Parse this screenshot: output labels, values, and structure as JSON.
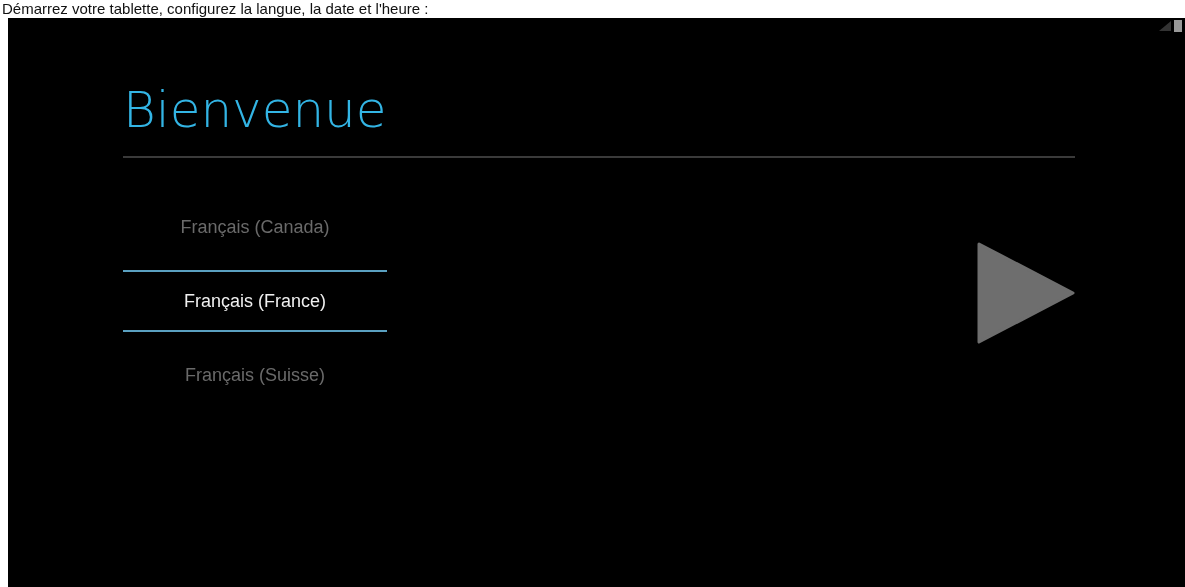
{
  "caption": "Démarrez votre tablette, configurez la langue, la date et l'heure :",
  "screen": {
    "title": "Bienvenue",
    "languages": [
      {
        "label": "Français (Canada)",
        "selected": false
      },
      {
        "label": "Français (France)",
        "selected": true
      },
      {
        "label": "Français (Suisse)",
        "selected": false
      }
    ]
  }
}
